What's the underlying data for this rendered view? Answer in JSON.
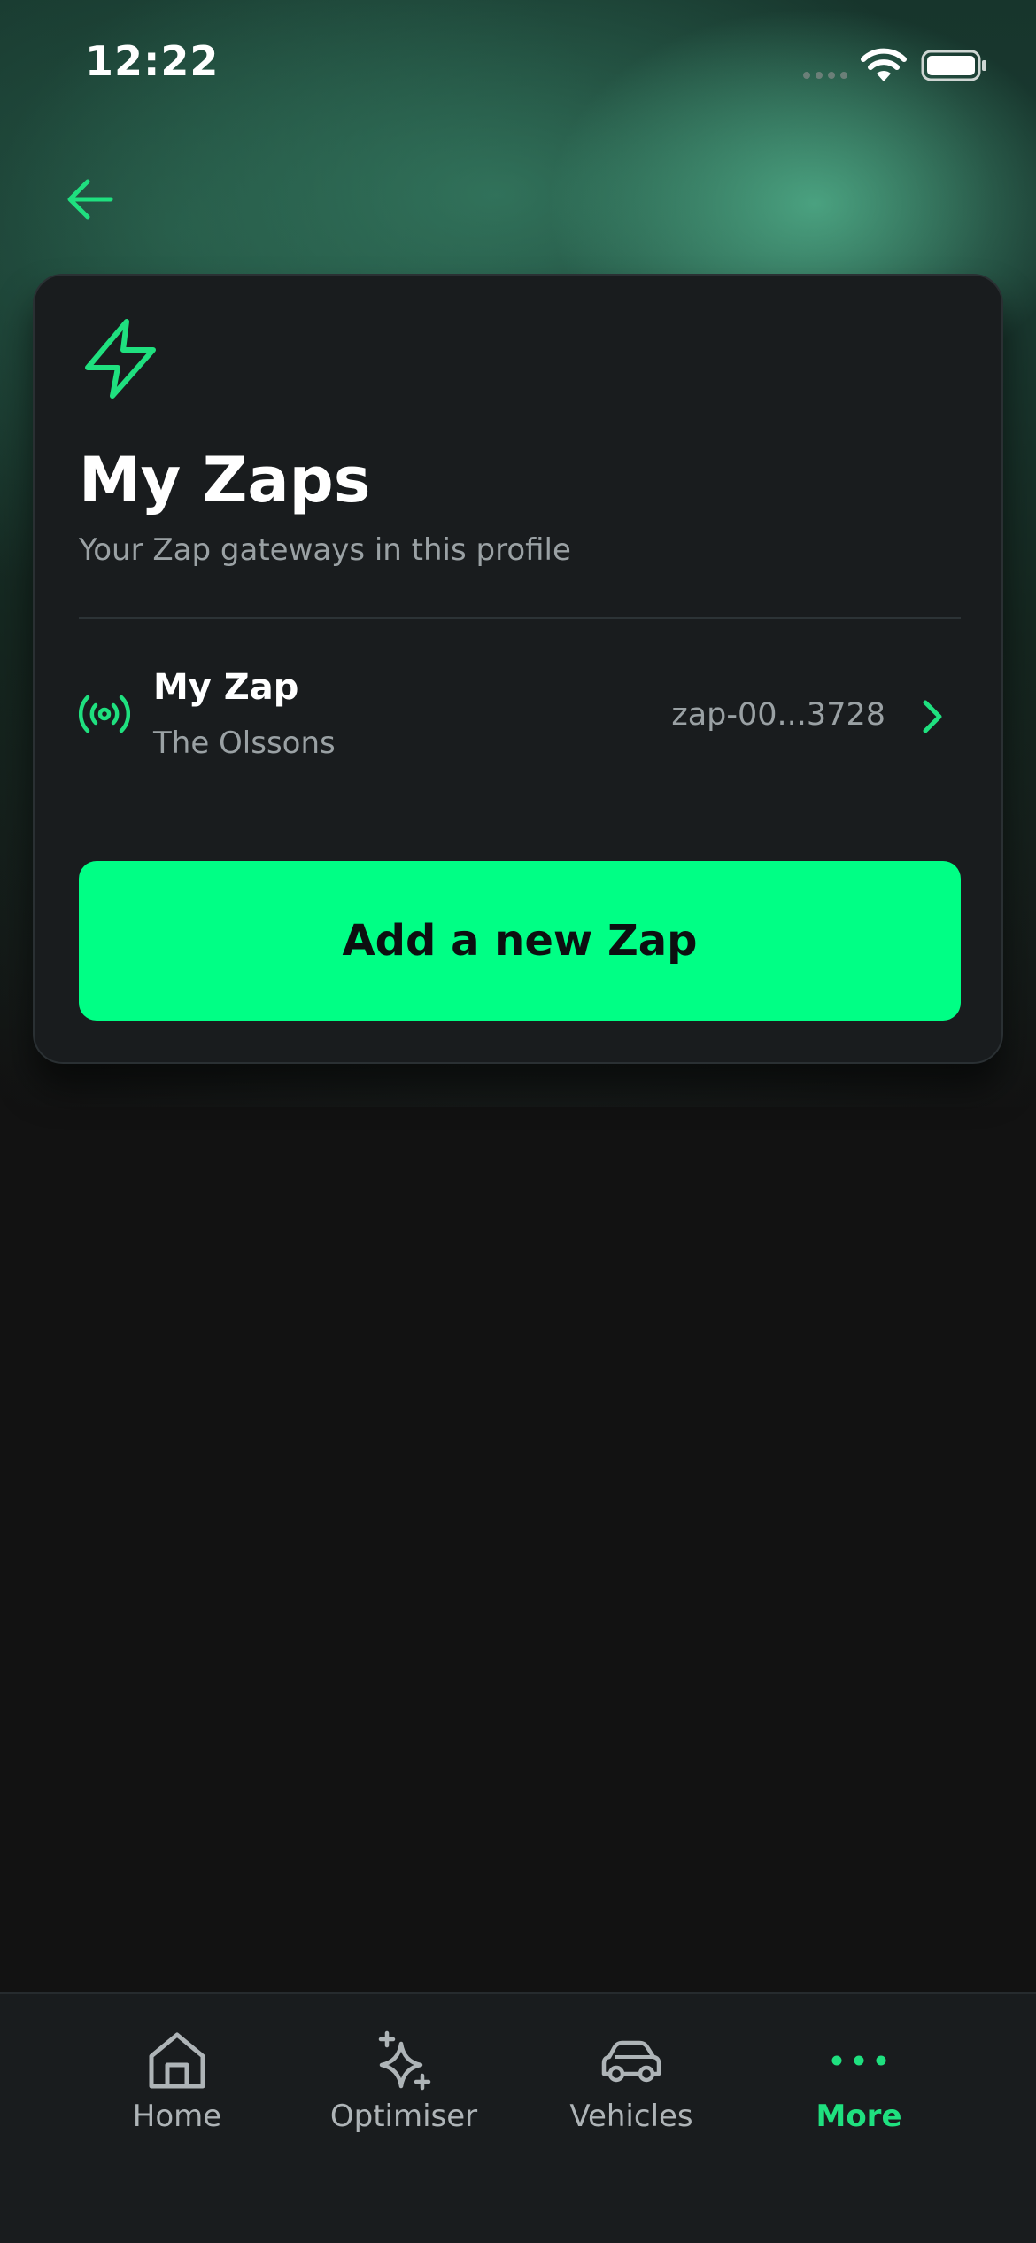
{
  "status_bar": {
    "time": "12:22"
  },
  "colors": {
    "accent": "#00ff85",
    "accent_icon": "#1fe07f",
    "card_bg": "#191c1e",
    "page_bg": "#121212",
    "muted_text": "#9aa1a4"
  },
  "header": {
    "back_icon": "arrow-left-icon"
  },
  "card": {
    "icon": "lightning-bolt-icon",
    "title": "My Zaps",
    "subtitle": "Your Zap gateways in this profile",
    "zaps": [
      {
        "icon": "radio-broadcast-icon",
        "name": "My Zap",
        "owner": "The Olssons",
        "id": "zap-00...3728"
      }
    ],
    "add_button_label": "Add a new Zap"
  },
  "tab_bar": {
    "items": [
      {
        "label": "Home",
        "icon": "home-icon",
        "active": false
      },
      {
        "label": "Optimiser",
        "icon": "sparkles-icon",
        "active": false
      },
      {
        "label": "Vehicles",
        "icon": "car-icon",
        "active": false
      },
      {
        "label": "More",
        "icon": "more-dots-icon",
        "active": true
      }
    ]
  }
}
